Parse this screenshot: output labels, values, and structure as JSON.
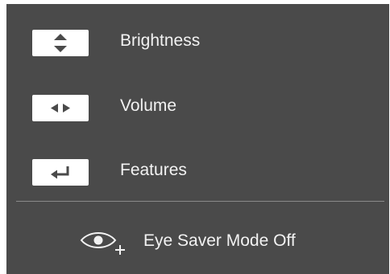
{
  "osd": {
    "background_color": "#4a4a4a",
    "text_color": "#f2f2f2",
    "badge_color": "#ffffff",
    "menu": [
      {
        "label": "Brightness",
        "icon": "up-down-arrows-icon"
      },
      {
        "label": "Volume",
        "icon": "left-right-arrows-icon"
      },
      {
        "label": "Features",
        "icon": "enter-return-icon"
      }
    ],
    "eye_saver": {
      "label": "Eye Saver Mode Off",
      "icon": "eye-plus-icon"
    }
  }
}
